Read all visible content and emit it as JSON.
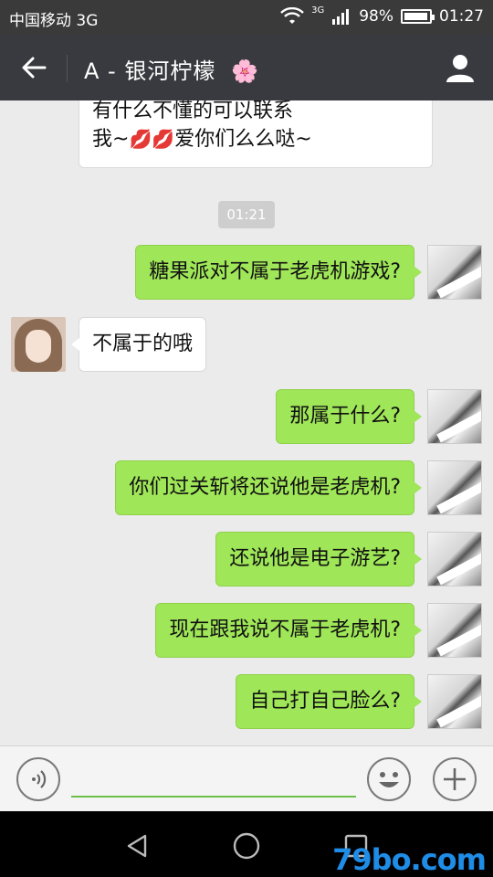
{
  "status_bar": {
    "carrier": "中国移动 3G",
    "signal_label": "3G",
    "battery": "98%",
    "battery_level": 0.98,
    "time": "01:27"
  },
  "header": {
    "title": "A - 银河柠檬",
    "title_emoji": "🌸"
  },
  "chat": {
    "previous_message": {
      "line1": "有什么不懂的可以联系",
      "line2_prefix": "我~",
      "line2_emoji": "💋💋",
      "line2_suffix": "爱你们么么哒~"
    },
    "timestamp": "01:21",
    "messages": [
      {
        "from": "me",
        "text": "糖果派对不属于老虎机游戏?"
      },
      {
        "from": "them",
        "text": "不属于的哦"
      },
      {
        "from": "me",
        "text": "那属于什么?"
      },
      {
        "from": "me",
        "text": "你们过关斩将还说他是老虎机?"
      },
      {
        "from": "me",
        "text": "还说他是电子游艺?"
      },
      {
        "from": "me",
        "text": "现在跟我说不属于老虎机?"
      },
      {
        "from": "me",
        "text": "自己打自己脸么?"
      }
    ]
  },
  "input_bar": {
    "text_value": ""
  },
  "watermark": "79bo.com",
  "colors": {
    "header_bg": "#393a3f",
    "bubble_out": "#9fe658",
    "bubble_in": "#ffffff",
    "chat_bg": "#ebebeb"
  }
}
